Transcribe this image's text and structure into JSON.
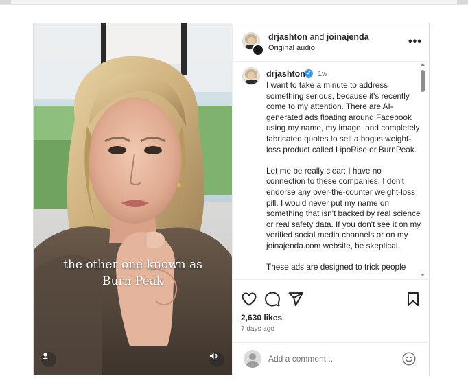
{
  "post": {
    "header": {
      "author": "drjashton",
      "connector": "and",
      "collaborator": "joinajenda",
      "subtitle": "Original audio",
      "more_label": "•••"
    },
    "video": {
      "caption_line1": "the other one known as",
      "caption_line2": "Burn Peak"
    },
    "comment": {
      "username": "drjashton",
      "verified_mark": "✔",
      "time": "1w",
      "paragraphs": [
        "I want to take a minute to address something serious, because it's recently come to my attention. There are AI-generated ads floating around Facebook using my name, my image, and completely fabricated quotes to sell a bogus weight-loss product called LipoRise or BurnPeak.",
        "Let me be really clear: I have no connection to these companies. I don't endorse any over-the-counter weight-loss pill. I would never put my name on something that isn't backed by real science or real safety data.  If you don't see it on my verified social media channels or on my joinajenda.com website, be skeptical.",
        "These ads are designed to trick people"
      ]
    },
    "actions": {
      "likes": "2,630 likes",
      "date": "7 days ago"
    },
    "add_comment": {
      "placeholder": "Add a comment..."
    }
  },
  "icons": [
    "heart-icon",
    "comment-icon",
    "share-icon",
    "bookmark-icon",
    "emoji-icon",
    "person-icon",
    "volume-icon",
    "more-icon",
    "verified-icon"
  ]
}
